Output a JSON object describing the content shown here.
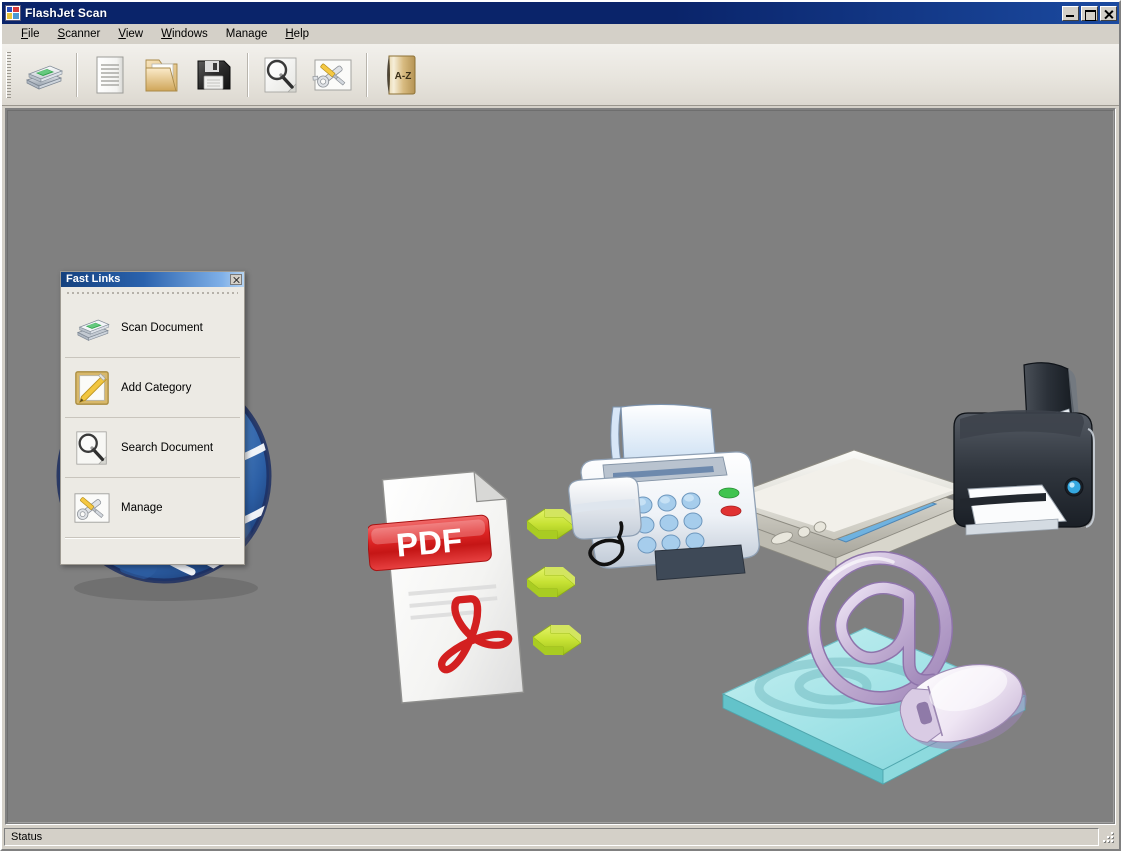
{
  "window": {
    "title": "FlashJet Scan",
    "icon": "app-icon",
    "controls": {
      "minimize": "Minimize",
      "maximize": "Maximize",
      "close": "Close"
    }
  },
  "menubar": {
    "items": [
      {
        "label": "File",
        "accel": "F"
      },
      {
        "label": "Scanner",
        "accel": "S"
      },
      {
        "label": "View",
        "accel": "V"
      },
      {
        "label": "Windows",
        "accel": "W"
      },
      {
        "label": "Manage",
        "accel": "M"
      },
      {
        "label": "Help",
        "accel": "H"
      }
    ]
  },
  "toolbar": {
    "buttons": [
      {
        "name": "scan-document",
        "icon": "scanner-icon",
        "tooltip": "Scan Document"
      },
      {
        "name": "new-document",
        "icon": "document-icon",
        "tooltip": "Document"
      },
      {
        "name": "open-folder",
        "icon": "folder-icon",
        "tooltip": "Open Folder"
      },
      {
        "name": "save",
        "icon": "floppy-disk-icon",
        "tooltip": "Save"
      },
      {
        "name": "search",
        "icon": "magnifier-icon",
        "tooltip": "Search Document"
      },
      {
        "name": "manage",
        "icon": "tools-icon",
        "tooltip": "Manage"
      },
      {
        "name": "index",
        "icon": "az-book-icon",
        "tooltip": "A-Z Index",
        "label": "A-Z"
      }
    ],
    "separators_after": [
      0,
      3
    ]
  },
  "fast_links": {
    "title": "Fast Links",
    "close_label": "Close",
    "items": [
      {
        "label": "Scan Document",
        "icon": "scanner-icon"
      },
      {
        "label": "Add Category",
        "icon": "notepad-pencil-icon"
      },
      {
        "label": "Search Document",
        "icon": "magnifier-icon"
      },
      {
        "label": "Manage",
        "icon": "tools-icon"
      }
    ]
  },
  "scene": {
    "description": "Document workflow illustration",
    "elements": [
      {
        "name": "globe",
        "label": "Network globe"
      },
      {
        "name": "pdf-document",
        "label": "PDF",
        "badge_text": "PDF"
      },
      {
        "name": "green-arrows",
        "label": "Transfer arrows",
        "count": 3
      },
      {
        "name": "fax-machine",
        "label": "Fax machine"
      },
      {
        "name": "flatbed-scanner",
        "label": "Flatbed scanner"
      },
      {
        "name": "inkjet-printer",
        "label": "Inkjet printer"
      },
      {
        "name": "mousepad-at-symbol",
        "label": "E-mail at symbol with mouse"
      }
    ]
  },
  "statusbar": {
    "text": "Status"
  },
  "colors": {
    "titlebar": "#0a246a",
    "panel_title": "#15417e",
    "canvas_background": "#808080",
    "chrome": "#d4d0c8",
    "pdf_red": "#e12d2d",
    "arrow_green": "#c4e03a",
    "mousepad_cyan": "#a7e4e6",
    "globe_blue": "#2e6bb5",
    "book_gold": "#c9a95f"
  }
}
